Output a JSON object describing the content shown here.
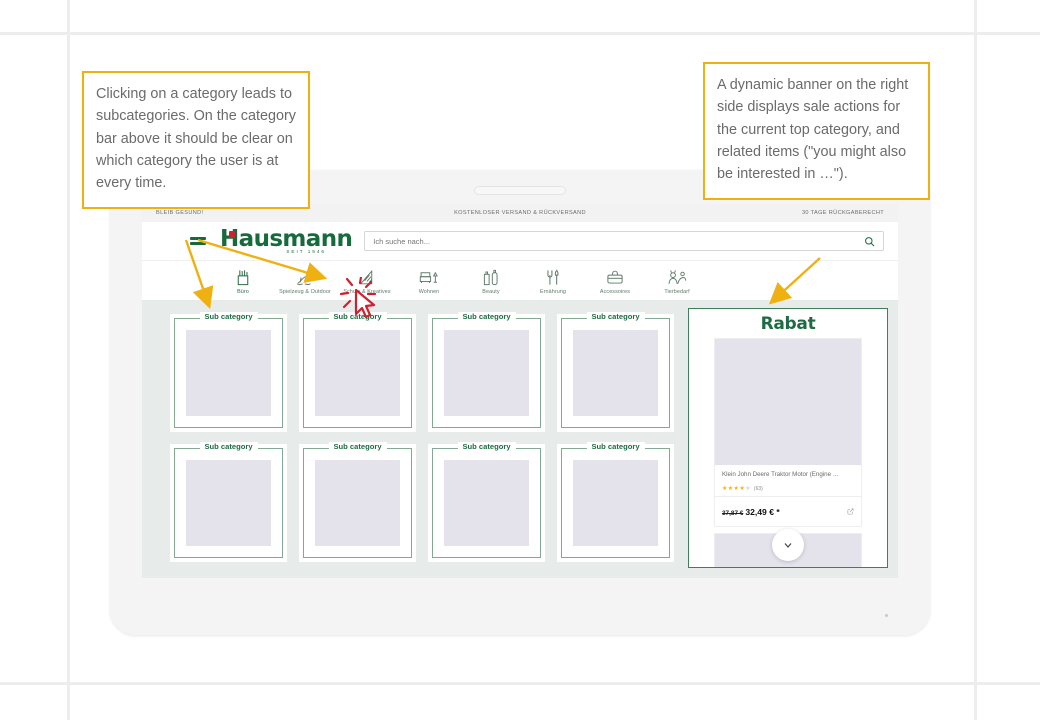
{
  "annotations": {
    "left": "Clicking on a category leads to subcategories. On the category bar above it should be clear on which category the user is at every time.",
    "right": "A dynamic banner on the right side displays sale actions for the current top category, and related items (\"you might also be interested in …\")."
  },
  "colors": {
    "accent_brand": "#176a3c",
    "callout_border": "#eeb111",
    "arrow": "#eeb111",
    "banner_border": "#3f7d5b",
    "cursor_red": "#d0202f",
    "page_bg": "#e7ecea"
  },
  "site": {
    "promo_bar": [
      "BLEIB GESUND!",
      "KOSTENLOSER VERSAND & RÜCKVERSAND",
      "30 TAGE RÜCKGABERECHT"
    ],
    "logo": {
      "word": "Hausmann",
      "tagline": "SEIT 1946"
    },
    "search": {
      "placeholder": "Ich suche nach...",
      "value": ""
    },
    "categories": [
      {
        "label": "Büro",
        "icon": "pen-cup-icon",
        "active": true
      },
      {
        "label": "Spielzeug & Outdoor",
        "icon": "rocking-horse-icon",
        "active": false
      },
      {
        "label": "Schule & Kreatives",
        "icon": "set-square-icon",
        "active": false
      },
      {
        "label": "Wohnen",
        "icon": "sofa-lamp-icon",
        "active": false
      },
      {
        "label": "Beauty",
        "icon": "bottles-icon",
        "active": false
      },
      {
        "label": "Ernährung",
        "icon": "cutlery-icon",
        "active": false
      },
      {
        "label": "Accessoires",
        "icon": "bag-icon",
        "active": false
      },
      {
        "label": "Tierbedarf",
        "icon": "pets-icon",
        "active": false
      }
    ],
    "subcategories": [
      {
        "label": "Sub category"
      },
      {
        "label": "Sub category"
      },
      {
        "label": "Sub category"
      },
      {
        "label": "Sub category"
      },
      {
        "label": "Sub category"
      },
      {
        "label": "Sub category"
      },
      {
        "label": "Sub category"
      },
      {
        "label": "Sub category"
      }
    ],
    "banner": {
      "title": "Rabat",
      "product": {
        "name": "Klein John Deere Traktor Motor (Engine …",
        "stars_filled": 4,
        "stars_total": 5,
        "rating_count": "(63)",
        "price_old": "37,87 €",
        "price_new": "32,49 € *"
      }
    }
  }
}
